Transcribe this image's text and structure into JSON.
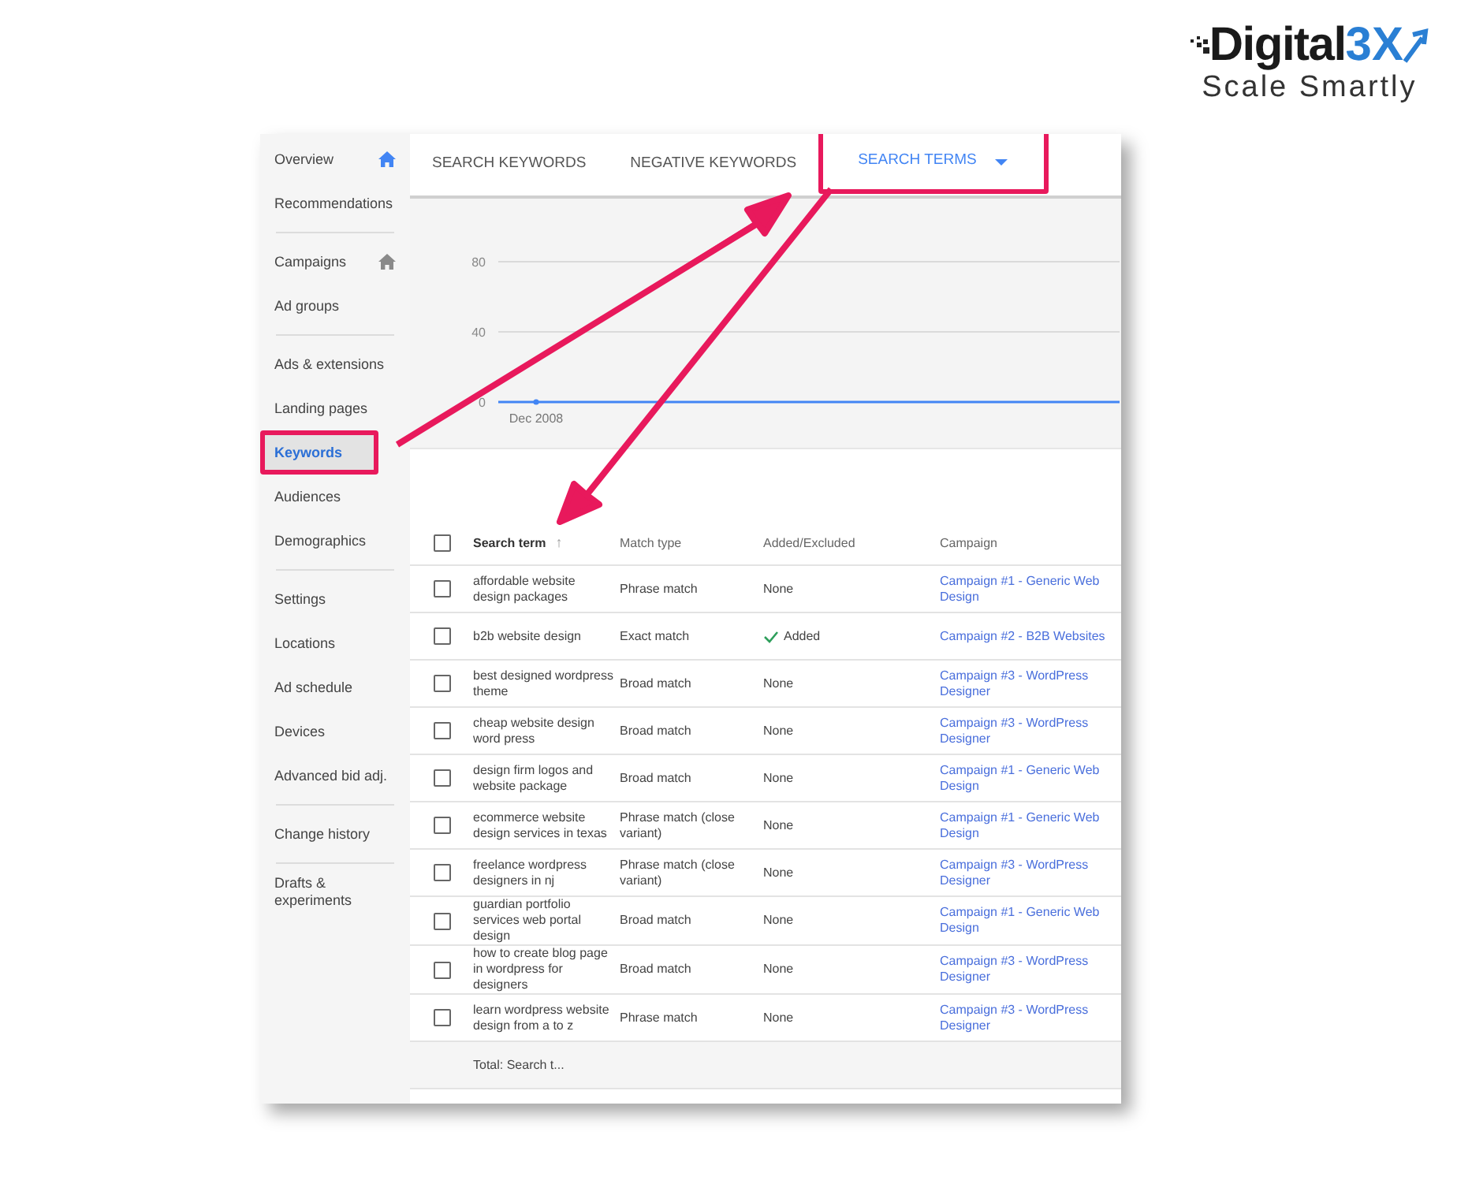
{
  "logo": {
    "name": "Digital",
    "suffix": "3X",
    "tagline": "Scale Smartly"
  },
  "sidebar": {
    "groups": [
      [
        {
          "label": "Overview",
          "home_active": true,
          "selected": false,
          "highlighted": false
        },
        {
          "label": "Recommendations",
          "selected": false,
          "highlighted": false
        }
      ],
      [
        {
          "label": "Campaigns",
          "home_active": false,
          "selected": false,
          "highlighted": false
        },
        {
          "label": "Ad groups",
          "selected": false,
          "highlighted": false
        }
      ],
      [
        {
          "label": "Ads & extensions",
          "selected": false,
          "highlighted": false
        },
        {
          "label": "Landing pages",
          "selected": false,
          "highlighted": false
        },
        {
          "label": "Keywords",
          "selected": true,
          "highlighted": true
        },
        {
          "label": "Audiences",
          "selected": false,
          "highlighted": false
        },
        {
          "label": "Demographics",
          "selected": false,
          "highlighted": false
        }
      ],
      [
        {
          "label": "Settings",
          "selected": false,
          "highlighted": false
        },
        {
          "label": "Locations",
          "selected": false,
          "highlighted": false
        },
        {
          "label": "Ad schedule",
          "selected": false,
          "highlighted": false
        },
        {
          "label": "Devices",
          "selected": false,
          "highlighted": false
        },
        {
          "label": "Advanced bid adj.",
          "selected": false,
          "highlighted": false
        }
      ],
      [
        {
          "label": "Change history",
          "selected": false,
          "highlighted": false
        }
      ],
      [
        {
          "label": "Drafts & experiments",
          "selected": false,
          "highlighted": false
        }
      ]
    ]
  },
  "tabs": [
    {
      "label": "SEARCH KEYWORDS",
      "selected": false,
      "highlighted": false,
      "dropdown": false
    },
    {
      "label": "NEGATIVE KEYWORDS",
      "selected": false,
      "highlighted": false,
      "dropdown": false
    },
    {
      "label": "SEARCH TERMS",
      "selected": true,
      "highlighted": true,
      "dropdown": true
    }
  ],
  "chart": {
    "chart_data": {
      "type": "line",
      "x": [
        "Dec 2008"
      ],
      "yticks": [
        0,
        40,
        80
      ],
      "ylim": [
        0,
        80
      ],
      "series": [
        {
          "color": "#4285f4",
          "marker": "circle",
          "values": [
            0
          ]
        }
      ]
    }
  },
  "table": {
    "header_checkbox": {
      "checked": false
    },
    "columns": [
      {
        "label": "Search term",
        "sort_arrow": "↑"
      },
      {
        "label": "Match type"
      },
      {
        "label": "Added/Excluded"
      },
      {
        "label": "Campaign"
      }
    ],
    "rows": [
      {
        "checked": false,
        "term": "affordable website design packages",
        "match": "Phrase match",
        "status": "None",
        "added": false,
        "campaign": "Campaign #1 - Generic Web Design"
      },
      {
        "checked": false,
        "term": "b2b website design",
        "match": "Exact match",
        "status": "Added",
        "added": true,
        "campaign": "Campaign #2 - B2B Websites"
      },
      {
        "checked": false,
        "term": "best designed wordpress theme",
        "match": "Broad match",
        "status": "None",
        "added": false,
        "campaign": "Campaign #3 - WordPress Designer"
      },
      {
        "checked": false,
        "term": "cheap website design word press",
        "match": "Broad match",
        "status": "None",
        "added": false,
        "campaign": "Campaign #3 - WordPress Designer"
      },
      {
        "checked": false,
        "term": "design firm logos and website package",
        "match": "Broad match",
        "status": "None",
        "added": false,
        "campaign": "Campaign #1 - Generic Web Design"
      },
      {
        "checked": false,
        "term": "ecommerce website design services in texas",
        "match": "Phrase match (close variant)",
        "status": "None",
        "added": false,
        "campaign": "Campaign #1 - Generic Web Design"
      },
      {
        "checked": false,
        "term": "freelance wordpress designers in nj",
        "match": "Phrase match (close variant)",
        "status": "None",
        "added": false,
        "campaign": "Campaign #3 - WordPress Designer"
      },
      {
        "checked": false,
        "term": "guardian portfolio services web portal design",
        "match": "Broad match",
        "status": "None",
        "added": false,
        "campaign": "Campaign #1 - Generic Web Design"
      },
      {
        "checked": false,
        "term": "how to create blog page in wordpress for designers",
        "match": "Broad match",
        "status": "None",
        "added": false,
        "campaign": "Campaign #3 - WordPress Designer"
      },
      {
        "checked": false,
        "term": "learn wordpress website design from a to z",
        "match": "Phrase match",
        "status": "None",
        "added": false,
        "campaign": "Campaign #3 - WordPress Designer"
      }
    ],
    "total": "Total: Search t..."
  }
}
